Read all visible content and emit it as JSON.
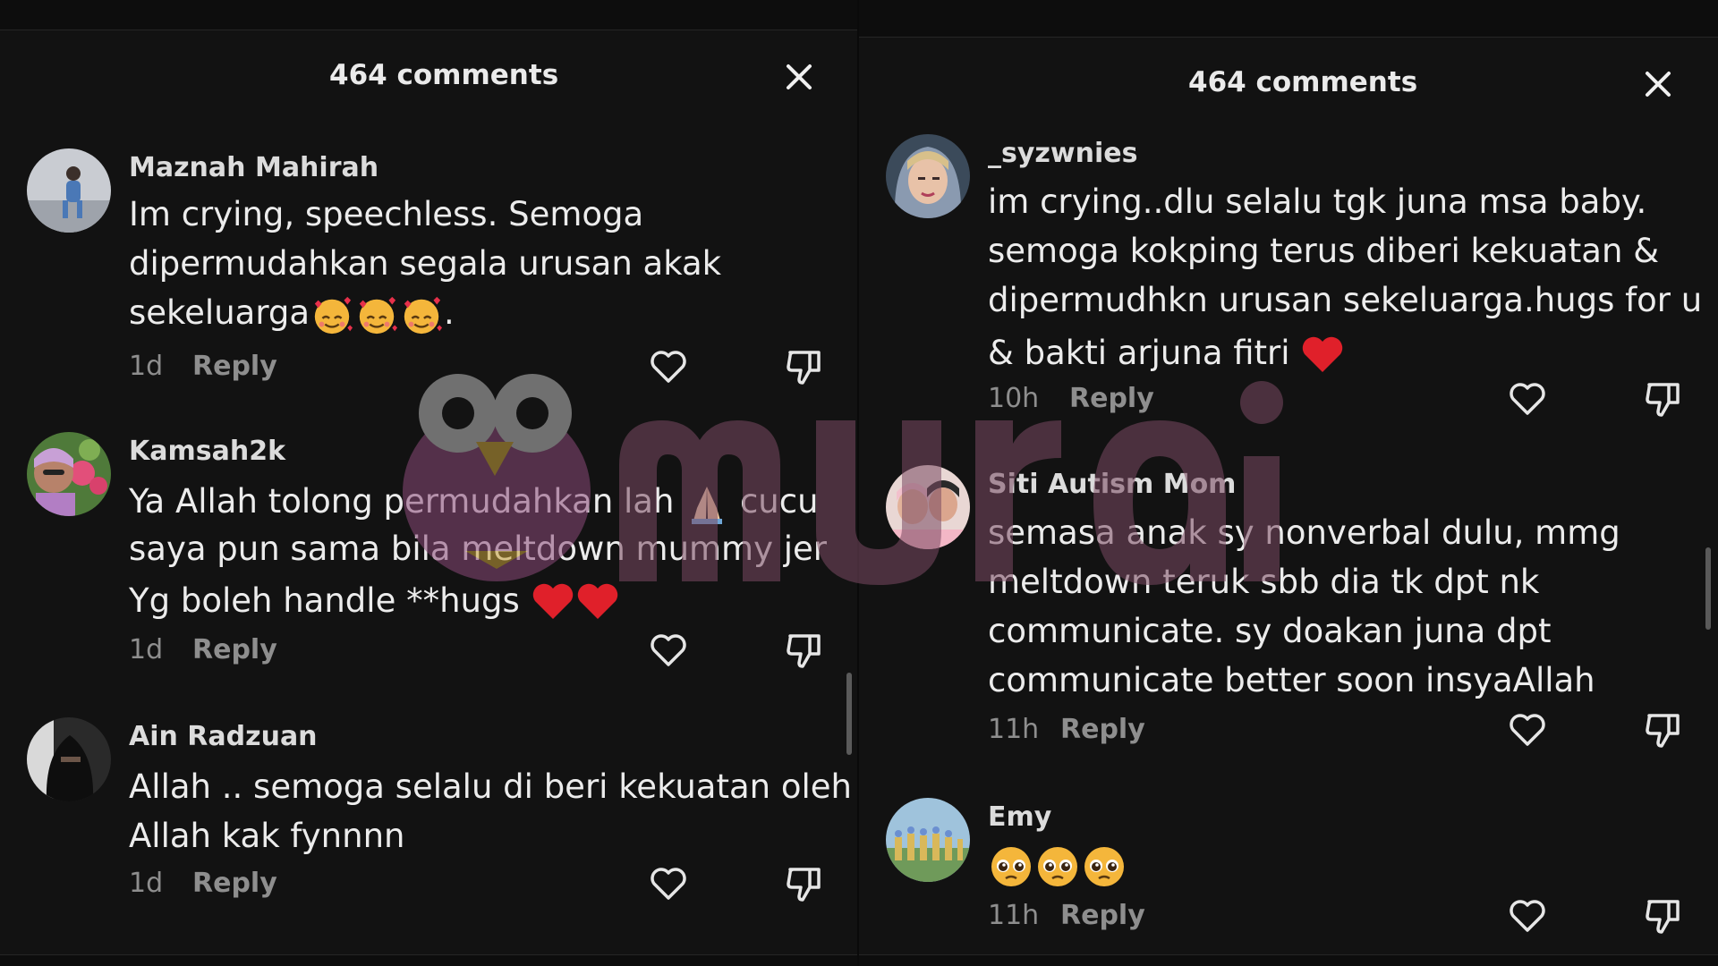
{
  "left": {
    "title": "464 comments",
    "comments": [
      {
        "user": "Maznah Mahirah",
        "lines": [
          "Im crying, speechless. Semoga",
          "dipermudahkan segala urusan akak",
          "sekeluarga"
        ],
        "trail": ".",
        "time": "1d",
        "reply": "Reply"
      },
      {
        "user": "Kamsah2k",
        "lines": [
          "Ya Allah tolong permudahkan lah",
          "saya pun sama bila meltdown mummy jer",
          "Yg boleh handle **hugs"
        ],
        "line1_after": "cucu",
        "time": "1d",
        "reply": "Reply"
      },
      {
        "user": "Ain Radzuan",
        "lines": [
          "Allah .. semoga selalu di beri kekuatan oleh",
          "Allah kak fynnnn"
        ],
        "time": "1d",
        "reply": "Reply"
      }
    ]
  },
  "right": {
    "title": "464 comments",
    "comments": [
      {
        "user": "_syzwnies",
        "lines": [
          "im crying..dlu selalu tgk juna msa baby.",
          "semoga kokping terus diberi kekuatan &",
          "dipermudhkn urusan sekeluarga.hugs for u",
          "& bakti arjuna fitri"
        ],
        "time": "10h",
        "reply": "Reply"
      },
      {
        "user": "Siti Autism Mom",
        "lines": [
          "semasa anak sy nonverbal dulu, mmg",
          "meltdown teruk sbb dia tk dpt nk",
          "communicate. sy doakan juna dpt",
          "communicate better soon insyaAllah"
        ],
        "time": "11h",
        "reply": "Reply"
      },
      {
        "user": "Emy",
        "time": "11h",
        "reply": "Reply"
      }
    ]
  },
  "watermark": {
    "text": "murai"
  },
  "colors": {
    "background": "#121212",
    "text": "#ececec",
    "muted": "#8e8e8e",
    "heart_red": "#e0202a",
    "watermark": "#7a4a62"
  },
  "icons": [
    "close-icon",
    "heart-outline-icon",
    "thumbs-down-icon",
    "smiling-hearts-emoji",
    "folded-hands-emoji",
    "red-heart-emoji",
    "pleading-face-emoji"
  ]
}
